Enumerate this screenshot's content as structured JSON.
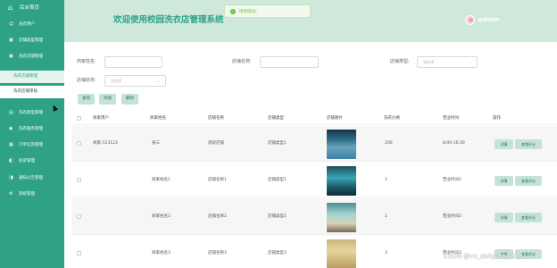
{
  "sidebar": {
    "home": {
      "icon": "home-icon",
      "label": "后台首页"
    },
    "items": [
      {
        "icon": "user-icon",
        "label": "洗衣用户"
      },
      {
        "icon": "shop-icon",
        "label": "店铺类型管理"
      },
      {
        "icon": "shop-icon",
        "label": "洗衣店铺管理"
      }
    ],
    "subitems": [
      {
        "label": "洗衣店铺管理",
        "state": "active"
      },
      {
        "label": "洗衣店铺审核"
      }
    ],
    "items2": [
      {
        "icon": "category-icon",
        "label": "洗衣类型管理"
      },
      {
        "icon": "service-icon",
        "label": "洗衣服务管理"
      },
      {
        "icon": "order-icon",
        "label": "订单信息管理"
      },
      {
        "icon": "feedback-icon",
        "label": "投诉管理"
      },
      {
        "icon": "notice-icon",
        "label": "通知公告管理"
      },
      {
        "icon": "settings-icon",
        "label": "系统管理"
      }
    ]
  },
  "header": {
    "title": "欢迎使用校园洗衣店管理系统",
    "toast": "修改成功!",
    "user": "admin"
  },
  "filters": {
    "owner_label": "商家姓名:",
    "shop_name_label": "店铺名称:",
    "shop_type_label": "店铺类型:",
    "shop_type_placeholder": "请选择",
    "shop_status_label": "店铺状态:",
    "shop_status_placeholder": "请选择",
    "search_btn": "查询",
    "add_btn": "添加",
    "delete_btn": "删除"
  },
  "table": {
    "headers": [
      "商家用户",
      "商家姓名",
      "店铺名称",
      "店铺类型",
      "店铺图片",
      "洗衣价格",
      "营业时间",
      "操作"
    ],
    "rows": [
      {
        "user": "商家-123123",
        "name": "张三",
        "shop": "测试店铺",
        "type": "店铺类型1",
        "price": "200",
        "hours": "8:00-16:30"
      },
      {
        "user": "",
        "name": "商家姓名1",
        "shop": "店铺名称1",
        "type": "店铺类型1",
        "price": "1",
        "hours": "营业时间1"
      },
      {
        "user": "",
        "name": "商家姓名2",
        "shop": "店铺名称2",
        "type": "店铺类型2",
        "price": "2",
        "hours": "营业时间2"
      },
      {
        "user": "",
        "name": "商家姓名3",
        "shop": "店铺名称3",
        "type": "店铺类型3",
        "price": "3",
        "hours": "营业时间3"
      }
    ],
    "detail_btn": "详情",
    "review_btn": "查看评论"
  },
  "watermark": "CSDN @vx_dahpianjil889"
}
